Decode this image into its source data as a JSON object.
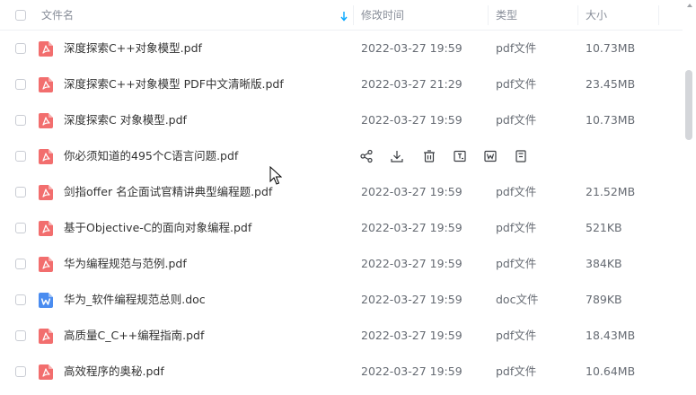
{
  "header": {
    "name": "文件名",
    "modified": "修改时间",
    "type": "类型",
    "size": "大小"
  },
  "hover_actions": [
    "share-icon",
    "download-icon",
    "delete-icon",
    "rename-icon",
    "open-word-icon",
    "more-icon"
  ],
  "files": [
    {
      "name": "深度探索C++对象模型.pdf",
      "time": "2022-03-27 19:59",
      "type": "pdf文件",
      "size": "10.73MB",
      "icon": "pdf-icon"
    },
    {
      "name": "深度探索C++对象模型 PDF中文清晰版.pdf",
      "time": "2022-03-27 21:29",
      "type": "pdf文件",
      "size": "23.45MB",
      "icon": "pdf-icon"
    },
    {
      "name": "深度探索C  对象模型.pdf",
      "time": "2022-03-27 19:59",
      "type": "pdf文件",
      "size": "10.73MB",
      "icon": "pdf-icon"
    },
    {
      "name": "你必须知道的495个C语言问题.pdf",
      "time": "",
      "type": "",
      "size": "",
      "icon": "pdf-icon"
    },
    {
      "name": "剑指offer 名企面试官精讲典型编程题.pdf",
      "time": "2022-03-27 19:59",
      "type": "pdf文件",
      "size": "21.52MB",
      "icon": "pdf-icon"
    },
    {
      "name": "基于Objective-C的面向对象编程.pdf",
      "time": "2022-03-27 19:59",
      "type": "pdf文件",
      "size": "521KB",
      "icon": "pdf-icon"
    },
    {
      "name": "华为编程规范与范例.pdf",
      "time": "2022-03-27 19:59",
      "type": "pdf文件",
      "size": "384KB",
      "icon": "pdf-icon"
    },
    {
      "name": "华为_软件编程规范总则.doc",
      "time": "2022-03-27 19:59",
      "type": "doc文件",
      "size": "789KB",
      "icon": "word-icon"
    },
    {
      "name": "高质量C_C++编程指南.pdf",
      "time": "2022-03-27 19:59",
      "type": "pdf文件",
      "size": "18.43MB",
      "icon": "pdf-icon"
    },
    {
      "name": "高效程序的奥秘.pdf",
      "time": "2022-03-27 19:59",
      "type": "pdf文件",
      "size": "10.64MB",
      "icon": "pdf-icon"
    }
  ],
  "colors": {
    "pdf": "#f26e6e",
    "word": "#4a8cf0",
    "accent": "#06a7ff"
  }
}
